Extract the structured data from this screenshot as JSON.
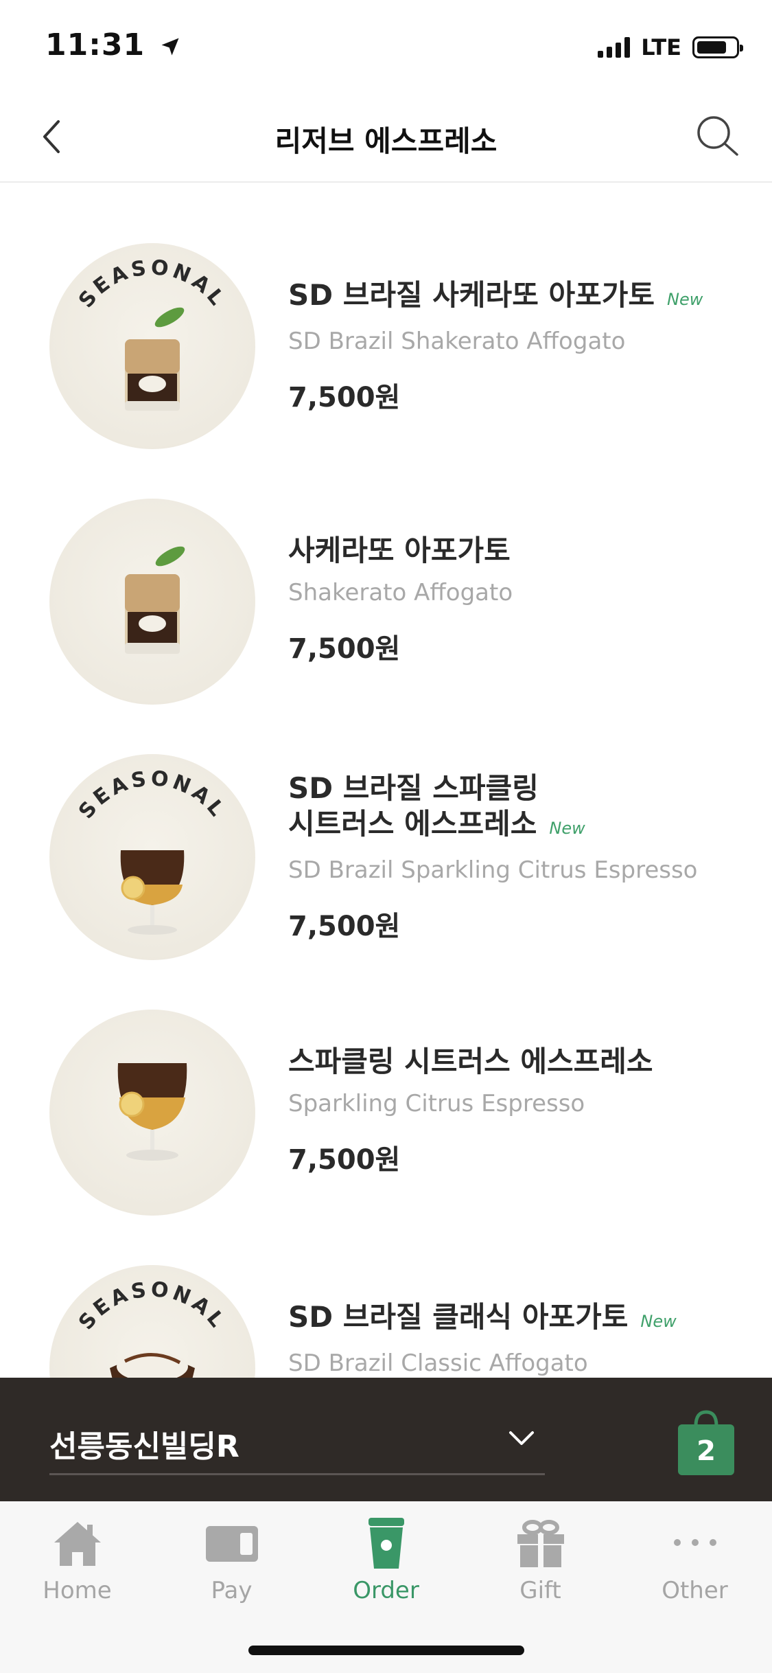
{
  "status_bar": {
    "time": "11:31",
    "network": "LTE"
  },
  "header": {
    "title": "리저브 에스프레소",
    "back_icon": "chevron-left-icon",
    "search_icon": "search-icon"
  },
  "products": [
    {
      "name_ko": "SD 브라질 사케라또 아포가토",
      "new": "New",
      "name_en": "SD Brazil Shakerato Affogato",
      "price": "7,500원",
      "seasonal": "SEASONAL"
    },
    {
      "name_ko": "사케라또 아포가토",
      "new": "",
      "name_en": "Shakerato Affogato",
      "price": "7,500원",
      "seasonal": ""
    },
    {
      "name_ko_line1": "SD 브라질 스파클링",
      "name_ko_line2": "시트러스 에스프레소",
      "new": "New",
      "name_en": "SD Brazil Sparkling Citrus Espresso",
      "price": "7,500원",
      "seasonal": "SEASONAL"
    },
    {
      "name_ko": "스파클링 시트러스 에스프레소",
      "new": "",
      "name_en": "Sparkling Citrus Espresso",
      "price": "7,500원",
      "seasonal": ""
    },
    {
      "name_ko": "SD 브라질 클래식 아포가토",
      "new": "New",
      "name_en": "SD Brazil Classic Affogato",
      "price": "",
      "seasonal": "SEASONAL"
    }
  ],
  "store_bar": {
    "store_name": "선릉동신빌딩R",
    "cart_count": "2"
  },
  "tabs": [
    {
      "label": "Home",
      "icon": "home-icon",
      "active": false
    },
    {
      "label": "Pay",
      "icon": "card-icon",
      "active": false
    },
    {
      "label": "Order",
      "icon": "cup-icon",
      "active": true
    },
    {
      "label": "Gift",
      "icon": "gift-icon",
      "active": false
    },
    {
      "label": "Other",
      "icon": "more-icon",
      "active": false
    }
  ],
  "colors": {
    "accent_green": "#3a9767",
    "new_badge": "#3fa06a",
    "store_bar_bg": "#2f2a27",
    "cart_green": "#3b8d5d"
  }
}
